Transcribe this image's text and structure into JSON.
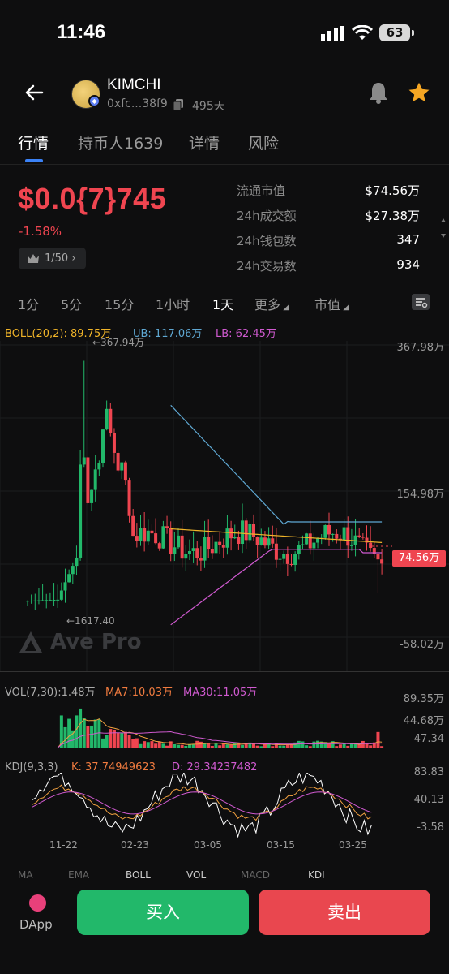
{
  "status_bar": {
    "time": "11:46",
    "battery": "63"
  },
  "header": {
    "name": "KIMCHI",
    "address": "0xfc...38f9",
    "age": "495天"
  },
  "tabs": [
    {
      "label": "行情",
      "active": true
    },
    {
      "label": "持币人1639",
      "active": false
    },
    {
      "label": "详情",
      "active": false
    },
    {
      "label": "风险",
      "active": false
    }
  ],
  "price": {
    "value": "$0.0{7}745",
    "change": "-1.58%",
    "rank": "1/50"
  },
  "stats": [
    {
      "label": "流通市值",
      "value": "$74.56万"
    },
    {
      "label": "24h成交额",
      "value": "$27.38万"
    },
    {
      "label": "24h钱包数",
      "value": "347"
    },
    {
      "label": "24h交易数",
      "value": "934"
    }
  ],
  "timeframes": [
    "1分",
    "5分",
    "15分",
    "1小时",
    "1天",
    "更多",
    "市值"
  ],
  "timeframe_active": "1天",
  "boll": {
    "label": "BOLL(20,2): 89.75万",
    "ub": "UB: 117.06万",
    "lb": "LB: 62.45万"
  },
  "price_axis": [
    "367.98万",
    "154.98万",
    "-58.02万"
  ],
  "price_marks": {
    "high": "←367.94万",
    "low": "←1617.40",
    "current": "74.56万"
  },
  "watermark": "Ave Pro",
  "vol": {
    "label": "VOL(7,30):1.48万",
    "ma7": "MA7:10.03万",
    "ma30": "MA30:11.05万",
    "axis": [
      "89.35万",
      "44.68万",
      "47.34"
    ]
  },
  "kdj": {
    "label": "KDJ(9,3,3)",
    "k": "K: 37.74949623",
    "d": "D: 29.34237482",
    "axis": [
      "83.83",
      "40.13",
      "-3.58"
    ]
  },
  "dates": [
    "11-22",
    "02-23",
    "03-05",
    "03-15",
    "03-25"
  ],
  "indicator_tabs": [
    "MA",
    "EMA",
    "BOLL",
    "VOL",
    "MACD",
    "KDJ"
  ],
  "bottom": {
    "dapp": "DApp",
    "buy": "买入",
    "sell": "卖出"
  },
  "colors": {
    "up": "#22b86a",
    "down": "#ef4550",
    "accent": "#3b82f6",
    "boll_mid": "#f0b429",
    "boll_ub": "#5fa8d3",
    "boll_lb": "#d05ad0"
  },
  "chart_data": [
    {
      "type": "candlestick",
      "title": "",
      "ylim": [
        -58.02,
        367.98
      ],
      "y_ticks": [
        367.98,
        154.98,
        -58.02
      ],
      "x_ticks": [
        "11-22",
        "02-23",
        "03-05",
        "03-15",
        "03-25"
      ],
      "series": [
        {
          "name": "BOLL",
          "values": [
            89.75
          ]
        },
        {
          "name": "UB",
          "values": [
            117.06
          ]
        },
        {
          "name": "LB",
          "values": [
            62.45
          ]
        }
      ],
      "current": 74.56
    },
    {
      "type": "bar",
      "title": "VOL(7,30)",
      "ylim": [
        0,
        89.35
      ],
      "series": [
        {
          "name": "MA7",
          "values": [
            10.03
          ]
        },
        {
          "name": "MA30",
          "values": [
            11.05
          ]
        }
      ]
    },
    {
      "type": "line",
      "title": "KDJ(9,3,3)",
      "ylim": [
        -3.58,
        83.83
      ],
      "series": [
        {
          "name": "K",
          "values": [
            37.74949623
          ]
        },
        {
          "name": "D",
          "values": [
            29.34237482
          ]
        }
      ]
    }
  ]
}
